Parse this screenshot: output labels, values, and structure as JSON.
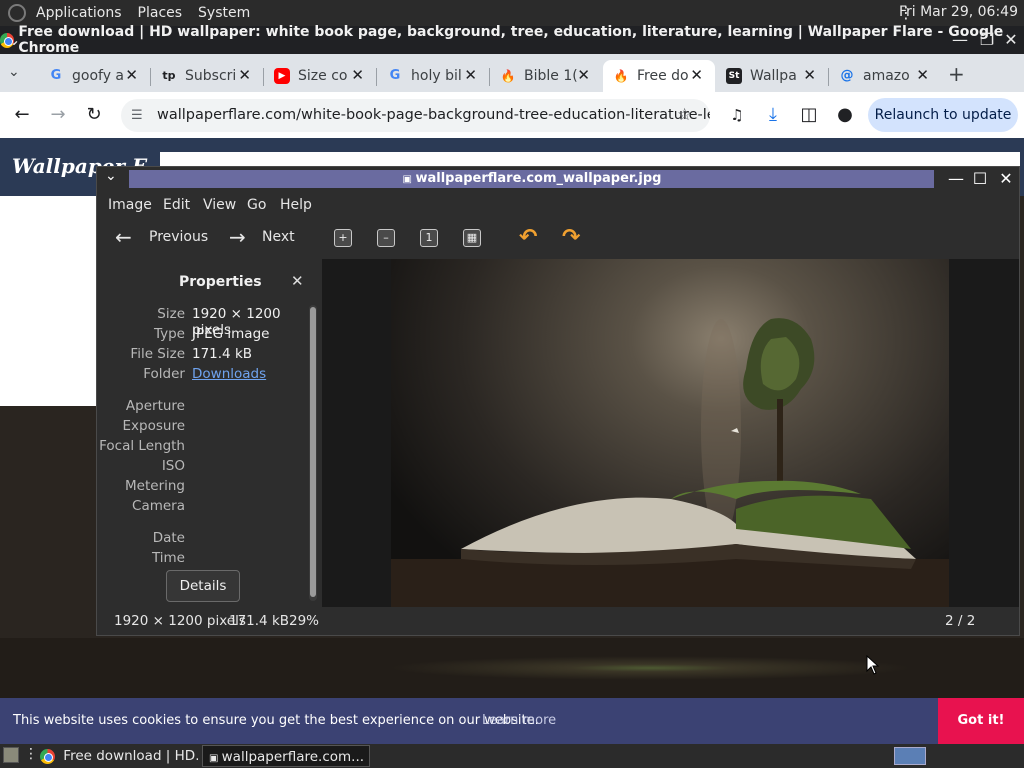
{
  "top_panel": {
    "menus": [
      "Applications",
      "Places",
      "System"
    ],
    "clock": "Fri Mar 29, 06:49"
  },
  "chrome": {
    "window_title": "Free download | HD wallpaper: white book page, background, tree, education, literature, learning | Wallpaper Flare - Google Chrome",
    "tabs": [
      {
        "label": "goofy a",
        "icon": "G"
      },
      {
        "label": "Subscri",
        "icon": "tp"
      },
      {
        "label": "Size co",
        "icon": "▶"
      },
      {
        "label": "holy bil",
        "icon": "G"
      },
      {
        "label": "Bible 1(",
        "icon": "🔥"
      },
      {
        "label": "Free do",
        "icon": "🔥"
      },
      {
        "label": "Wallpa",
        "icon": "St"
      },
      {
        "label": "amazo",
        "icon": "@"
      }
    ],
    "url": "wallpaperflare.com/white-book-page-background-tree-education-literature-lear...",
    "relaunch_label": "Relaunch to update"
  },
  "site": {
    "logo_text": "Wallpaper F",
    "cookie_message": "This website uses cookies to ensure you get the best experience on our website.",
    "cookie_learn": "Learn more",
    "cookie_button": "Got it!"
  },
  "viewer": {
    "title": "wallpaperflare.com_wallpaper.jpg",
    "menus": [
      "Image",
      "Edit",
      "View",
      "Go",
      "Help"
    ],
    "prev_label": "Previous",
    "next_label": "Next",
    "properties_title": "Properties",
    "props": {
      "size_label": "Size",
      "size_value": "1920 × 1200 pixels",
      "type_label": "Type",
      "type_value": "JPEG image",
      "filesize_label": "File Size",
      "filesize_value": "171.4 kB",
      "folder_label": "Folder",
      "folder_value": "Downloads",
      "aperture_label": "Aperture",
      "exposure_label": "Exposure",
      "focal_label": "Focal Length",
      "iso_label": "ISO",
      "metering_label": "Metering",
      "camera_label": "Camera",
      "date_label": "Date",
      "time_label": "Time"
    },
    "details_button": "Details",
    "status_dims": "1920 × 1200 pixels",
    "status_size": "171.4 kB",
    "status_zoom": "29%",
    "status_position": "2 / 2"
  },
  "taskbar": {
    "items": [
      "Free download | HD...",
      "wallpaperflare.com..."
    ]
  }
}
